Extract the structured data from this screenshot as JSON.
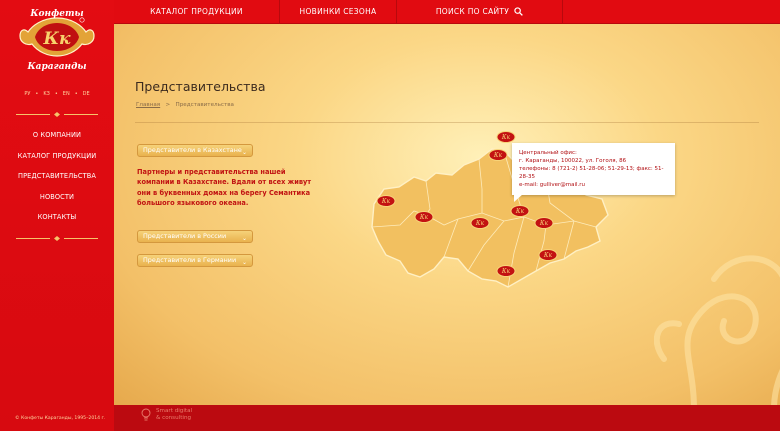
{
  "brand": {
    "top_text": "Конфеты",
    "bottom_text": "Караганды",
    "primary_color": "#e30c12",
    "accent_color": "#f7c66a"
  },
  "languages": [
    "РУ",
    "KЗ",
    "EN",
    "DE"
  ],
  "menu": [
    {
      "label": "О КОМПАНИИ"
    },
    {
      "label": "КАТАЛОГ ПРОДУКЦИИ"
    },
    {
      "label": "ПРЕДСТАВИТЕЛЬСТВА"
    },
    {
      "label": "НОВОСТИ"
    },
    {
      "label": "КОНТАКТЫ"
    }
  ],
  "copyright": "© Конфеты Караганды, 1995–2014 г.",
  "topnav": {
    "items": [
      {
        "label": "КАТАЛОГ ПРОДУКЦИИ"
      },
      {
        "label": "НОВИНКИ СЕЗОНА"
      },
      {
        "label": "ПОИСК ПО САЙТУ",
        "icon": "search-icon"
      }
    ]
  },
  "page": {
    "title": "Представительства",
    "breadcrumb_home": "Главная",
    "breadcrumb_sep": ">",
    "breadcrumb_current": "Представительства"
  },
  "dropdowns": {
    "kazakhstan": "Представители в Казахстане",
    "russia": "Представители в России",
    "germany": "Представители в Германии"
  },
  "description": "Партнеры и представительства нашей компании в Казахстане. Вдали от всех живут они в буквенных домах на берегу Семантика большого языкового океана.",
  "office": {
    "title": "Центральный офис:",
    "address": "г. Караганды, 100022, ул. Гоголя, 86",
    "phones": "телефоны: 8 (721-2) 51-28-06; 51-29-13; факс: 51-28-35",
    "email": "e-mail: gulliver@mail.ru"
  },
  "developer": {
    "line1": "Smart digital",
    "line2": "& consulting"
  }
}
